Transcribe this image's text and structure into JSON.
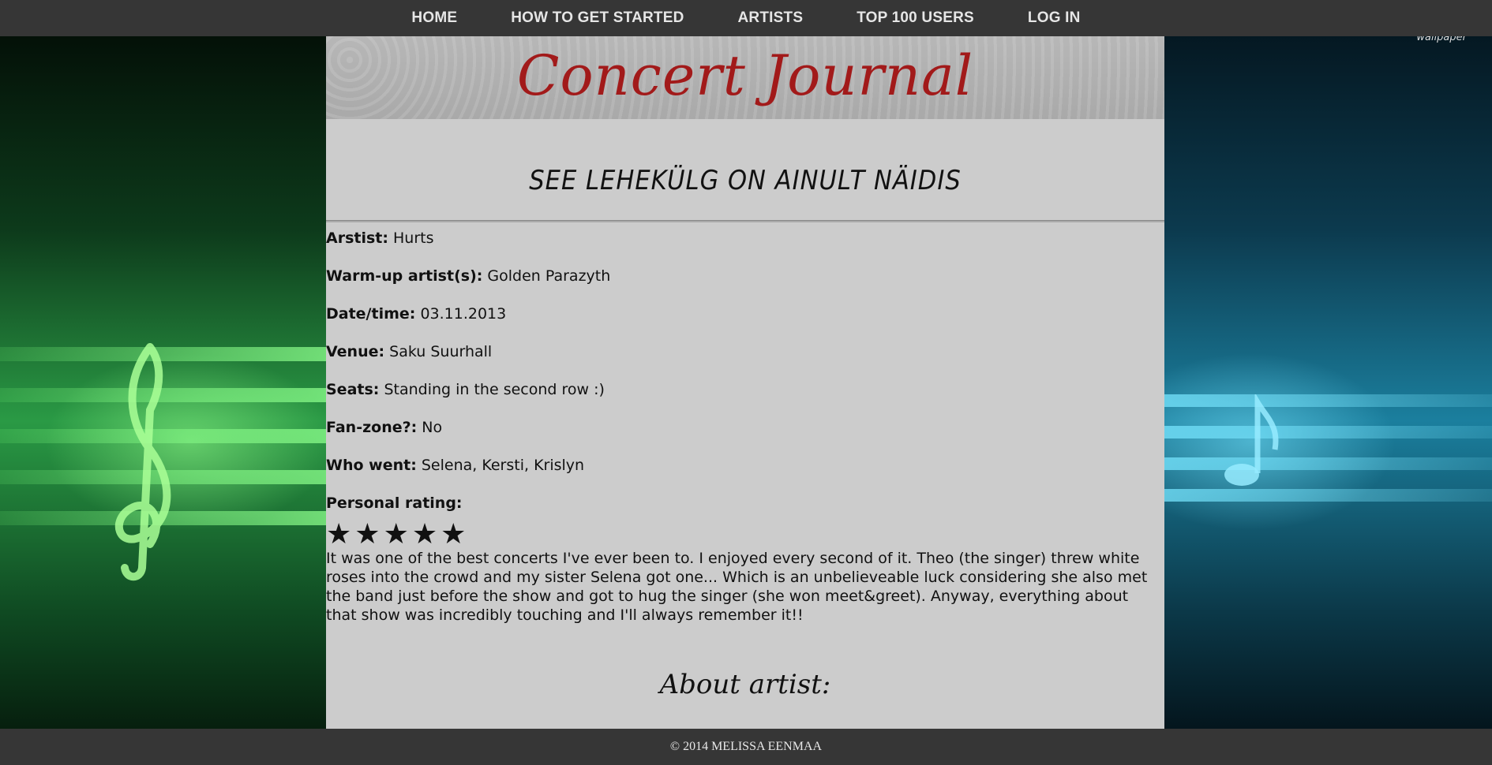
{
  "nav": {
    "items": [
      "HOME",
      "HOW TO GET STARTED",
      "ARTISTS",
      "TOP 100 USERS",
      "LOG IN"
    ]
  },
  "banner": {
    "logo": "Concert Journal"
  },
  "notice": "SEE LEHEKÜLG ON AINULT NÄIDIS",
  "concert": {
    "artist": {
      "label": "Arstist:",
      "value": "Hurts"
    },
    "warmup": {
      "label": "Warm-up artist(s):",
      "value": "Golden Parazyth"
    },
    "datetime": {
      "label": "Date/time:",
      "value": "03.11.2013"
    },
    "venue": {
      "label": "Venue:",
      "value": "Saku Suurhall"
    },
    "seats": {
      "label": "Seats:",
      "value": "Standing in the second row :)"
    },
    "fanzone": {
      "label": "Fan-zone?:",
      "value": "No"
    },
    "who_went": {
      "label": "Who went:",
      "value": "Selena, Kersti, Krislyn"
    },
    "rating": {
      "label": "Personal rating:",
      "stars": 5,
      "max": 5
    },
    "review": "It was one of the best concerts I've ever been to. I enjoyed every second of it. Theo (the singer) threw white roses into the crowd and my sister Selena got one... Which is an unbelieveable luck considering she also met the band just before the show and got to hug the singer (she won meet&greet). Anyway, everything about that show was incredibly touching and I'll always remember it!!"
  },
  "about_heading": "About artist:",
  "footer": "© 2014 MELISSA EENMAA",
  "watermark": "wallpaper",
  "colors": {
    "nav_bg": "#363636",
    "logo": "#a21a1a",
    "content_bg": "#cccccc"
  }
}
